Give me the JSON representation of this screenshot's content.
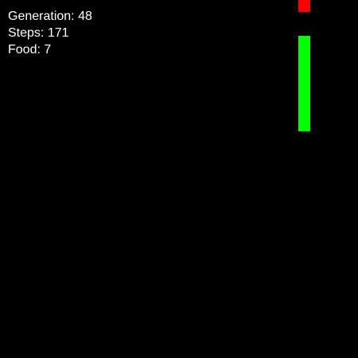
{
  "hud": {
    "generation_label": "Generation:",
    "generation_value": "48",
    "steps_label": "Steps:",
    "steps_value": "171",
    "food_label": "Food:",
    "food_value": "7"
  },
  "colors": {
    "background": "#000000",
    "text": "#ffffff",
    "snake": "#00ff00",
    "food": "#ff0000"
  },
  "game": {
    "snake_length_segments": 8
  }
}
